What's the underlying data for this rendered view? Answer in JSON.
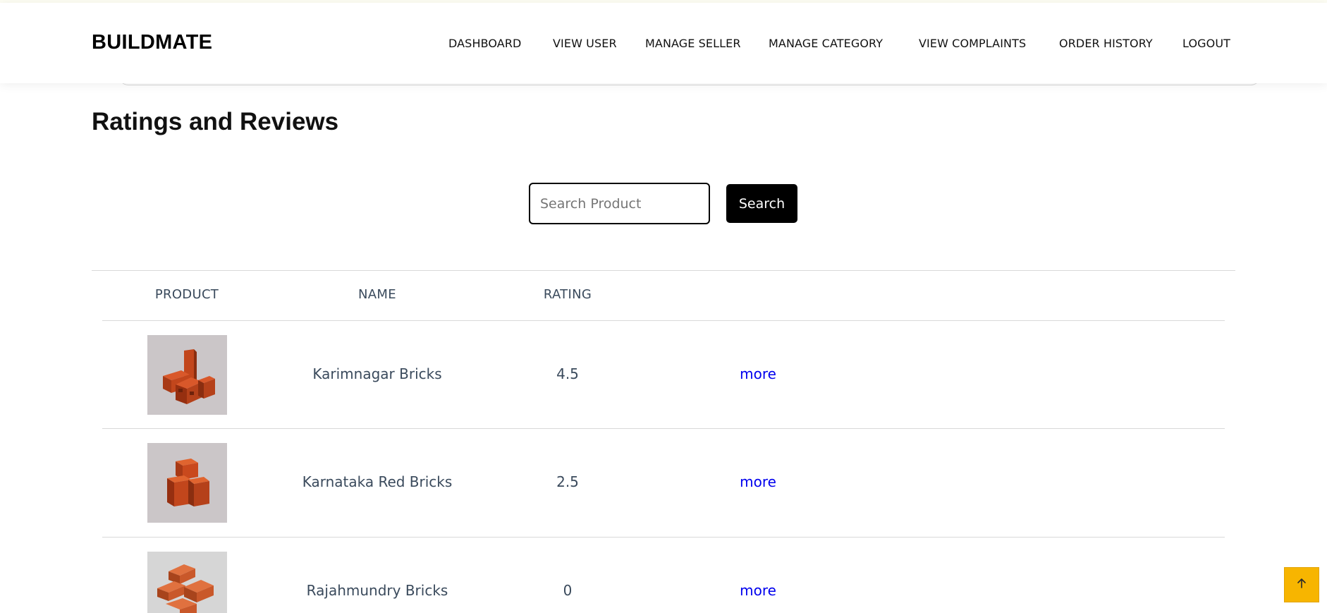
{
  "brand": "BUILDMATE",
  "nav": [
    {
      "label": "DASHBOARD"
    },
    {
      "label": "VIEW USER"
    },
    {
      "label": "MANAGE SELLER"
    },
    {
      "label": "MANAGE CATEGORY"
    },
    {
      "label": "VIEW COMPLAINTS"
    },
    {
      "label": "ORDER HISTORY"
    },
    {
      "label": "LOGOUT"
    }
  ],
  "page_title": "Ratings and Reviews",
  "search": {
    "placeholder": "Search Product",
    "value": "",
    "button_label": "Search"
  },
  "table": {
    "headers": [
      "PRODUCT",
      "NAME",
      "RATING"
    ],
    "rows": [
      {
        "name": "Karimnagar Bricks",
        "rating": "4.5",
        "link": "more"
      },
      {
        "name": "Karnataka Red Bricks",
        "rating": "2.5",
        "link": "more"
      },
      {
        "name": "Rajahmundry Bricks",
        "rating": "0",
        "link": "more"
      }
    ]
  },
  "colors": {
    "accent": "#f7b500",
    "link": "#0000ee",
    "brick": "#c2461c"
  },
  "icons": {
    "scroll_top": "arrow-up-icon"
  }
}
